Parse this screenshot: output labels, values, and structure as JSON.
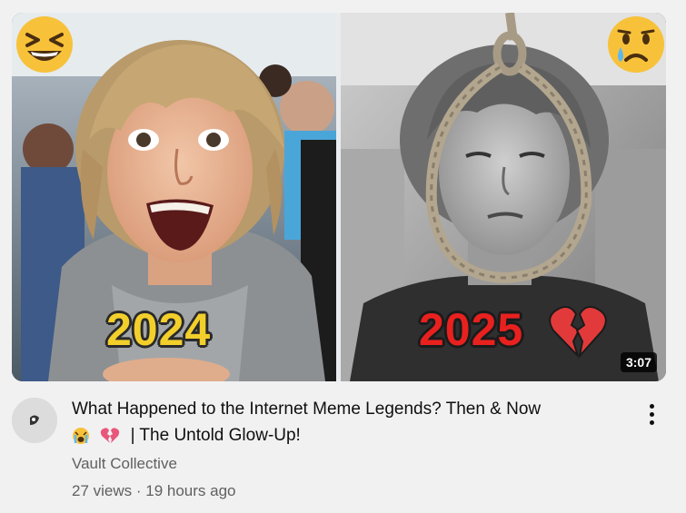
{
  "video": {
    "thumbnail": {
      "left_year": "2024",
      "right_year": "2025",
      "left_emoji": "laughing-emoji",
      "right_emoji": "crying-emoji",
      "heart": "broken-heart-emoji",
      "duration": "3:07"
    },
    "title_line1": "What Happened to the Internet Meme Legends? Then & Now",
    "title_line2": "| The Untold Glow-Up!",
    "title_emojis": [
      "crying-face-emoji",
      "broken-heart-emoji"
    ],
    "channel": "Vault Collective",
    "stats": "27 views · 19 hours ago",
    "menu_icon": "more-vert-icon"
  },
  "colors": {
    "year_2024": "#f2cf2b",
    "year_2025": "#e8211f",
    "meta_text": "#606060",
    "title_text": "#0f0f0f"
  }
}
